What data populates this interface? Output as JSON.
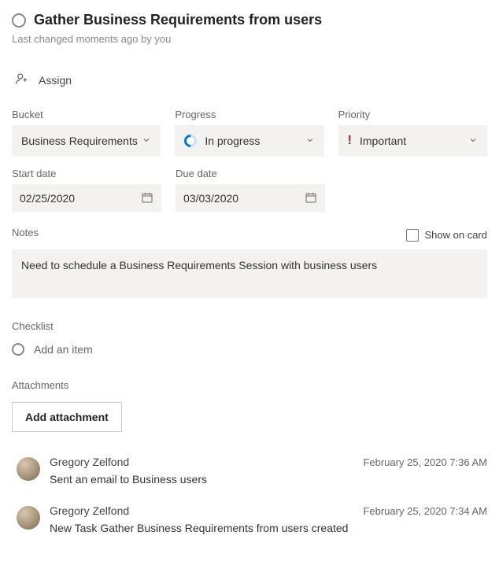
{
  "task": {
    "title": "Gather Business Requirements from users",
    "last_changed": "Last changed moments ago by you"
  },
  "assign": {
    "label": "Assign"
  },
  "fields": {
    "bucket": {
      "label": "Bucket",
      "value": "Business Requirements"
    },
    "progress": {
      "label": "Progress",
      "value": "In progress"
    },
    "priority": {
      "label": "Priority",
      "value": "Important"
    },
    "start_date": {
      "label": "Start date",
      "value": "02/25/2020"
    },
    "due_date": {
      "label": "Due date",
      "value": "03/03/2020"
    }
  },
  "notes": {
    "label": "Notes",
    "show_on_card": "Show on card",
    "text": "Need to schedule a Business Requirements Session with business users"
  },
  "checklist": {
    "label": "Checklist",
    "add_item": "Add an item"
  },
  "attachments": {
    "label": "Attachments",
    "add_button": "Add attachment"
  },
  "comments": [
    {
      "author": "Gregory Zelfond",
      "timestamp": "February 25, 2020 7:36 AM",
      "text": "Sent an email to Business users"
    },
    {
      "author": "Gregory Zelfond",
      "timestamp": "February 25, 2020 7:34 AM",
      "text": "New Task Gather Business Requirements from users created"
    }
  ]
}
